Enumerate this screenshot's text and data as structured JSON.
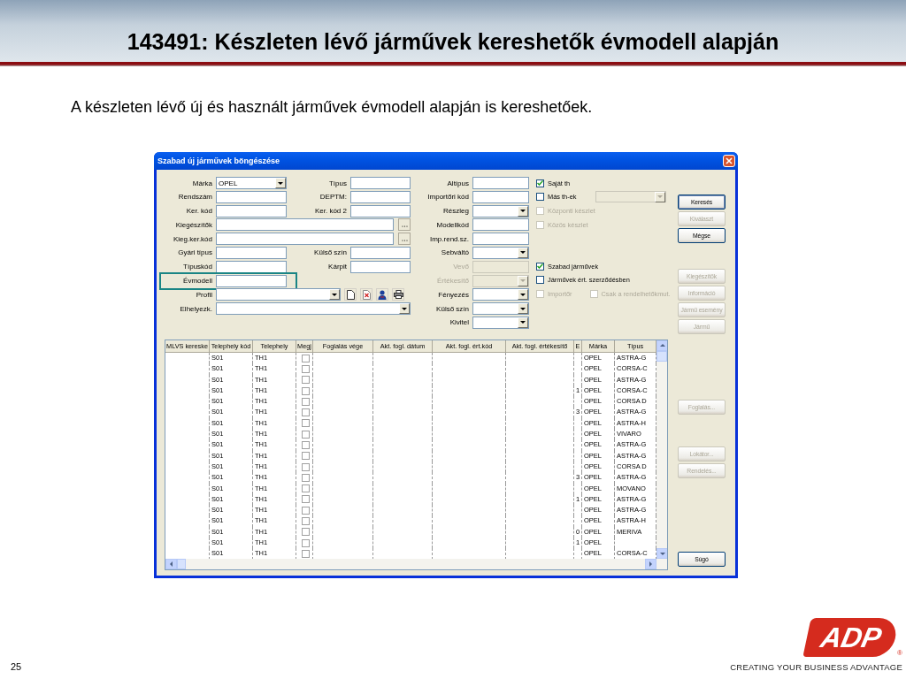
{
  "slide": {
    "title": "143491: Készleten lévő járművek kereshetők évmodell alapján",
    "subtitle": "A készleten lévő új és használt járművek évmodell alapján is kereshetőek.",
    "page_number": "25",
    "logo_text": "ADP",
    "logo_mark": "®",
    "tagline": "CREATING YOUR BUSINESS ADVANTAGE"
  },
  "window": {
    "title": "Szabad új járművek böngészése",
    "form_rows": [
      {
        "left": {
          "label": "Márka",
          "kind": "dropdown",
          "value": "OPEL",
          "disabled": false,
          "highlighted": false
        },
        "mid": {
          "label": "Típus",
          "kind": "text",
          "disabled": false
        },
        "right": {
          "label": "Altípus",
          "kind": "text",
          "disabled": false
        }
      },
      {
        "left": {
          "label": "Rendszám",
          "kind": "text",
          "disabled": false,
          "highlighted": false
        },
        "mid": {
          "label": "DEPTM:",
          "kind": "text",
          "disabled": false
        },
        "right": {
          "label": "Importőri kód",
          "kind": "text",
          "disabled": false
        }
      },
      {
        "left": {
          "label": "Ker. kód",
          "kind": "text",
          "disabled": false,
          "highlighted": false
        },
        "mid": {
          "label": "Ker. kód 2",
          "kind": "text",
          "disabled": false
        },
        "right": {
          "label": "Részleg",
          "kind": "dropdown",
          "disabled": false
        }
      },
      {
        "left": {
          "label": "Kiegészítők",
          "kind": "lookup",
          "disabled": false,
          "highlighted": false
        },
        "right": {
          "label": "Modellkód",
          "kind": "text",
          "disabled": false
        }
      },
      {
        "left": {
          "label": "Kieg.ker.kód",
          "kind": "lookup",
          "disabled": false,
          "highlighted": false
        },
        "right": {
          "label": "Imp.rend.sz.",
          "kind": "text",
          "disabled": false
        }
      },
      {
        "left": {
          "label": "Gyári típus",
          "kind": "text",
          "disabled": false,
          "highlighted": false
        },
        "mid": {
          "label": "Külső szín",
          "kind": "text",
          "disabled": false
        },
        "right": {
          "label": "Sebváltó",
          "kind": "dropdown",
          "disabled": false
        }
      },
      {
        "left": {
          "label": "Típuskód",
          "kind": "text",
          "disabled": false,
          "highlighted": false
        },
        "mid": {
          "label": "Kárpit",
          "kind": "text",
          "disabled": false
        },
        "right": {
          "label": "Vevő",
          "kind": "text",
          "disabled": true
        }
      },
      {
        "left": {
          "label": "Évmodell",
          "kind": "text",
          "disabled": false,
          "highlighted": true
        },
        "right": {
          "label": "Értékesítő",
          "kind": "dropdown",
          "disabled": true
        }
      },
      {
        "left": {
          "label": "Profil",
          "kind": "profile",
          "disabled": false,
          "highlighted": false
        },
        "right": {
          "label": "Fényezés",
          "kind": "dropdown",
          "disabled": false
        }
      },
      {
        "left": {
          "label": "Elhelyezk.",
          "kind": "wide_dropdown",
          "disabled": false,
          "highlighted": false
        },
        "right": {
          "label": "Külső szín",
          "kind": "dropdown",
          "disabled": false
        }
      },
      {
        "right": {
          "label": "Kivitel",
          "kind": "dropdown",
          "disabled": false
        }
      }
    ],
    "option_blocks": [
      {
        "lines": [
          [
            {
              "kind": "checkbox",
              "label": "Saját th",
              "checked": true,
              "disabled": false
            }
          ],
          [
            {
              "kind": "checkbox",
              "label": "Más th-ek",
              "checked": false,
              "disabled": false
            },
            {
              "kind": "combo",
              "disabled": true
            }
          ],
          [
            {
              "kind": "checkbox",
              "label": "Központi készlet",
              "checked": false,
              "disabled": true
            }
          ],
          [
            {
              "kind": "checkbox",
              "label": "Közös készlet",
              "checked": false,
              "disabled": true
            }
          ]
        ]
      },
      {
        "lines": [
          [
            {
              "kind": "checkbox",
              "label": "Szabad járművek",
              "checked": true,
              "disabled": false
            }
          ],
          [
            {
              "kind": "checkbox",
              "label": "Járművek ért. szerződésben",
              "checked": false,
              "disabled": false
            }
          ],
          [
            {
              "kind": "checkbox",
              "label": "Importőr",
              "checked": false,
              "disabled": true
            },
            {
              "kind": "checkbox",
              "label": "Csak a rendelhetőkmut.",
              "checked": false,
              "disabled": true
            }
          ]
        ]
      }
    ],
    "button_groups": [
      [
        {
          "label": "Keresés",
          "disabled": false,
          "default": true
        },
        {
          "label": "Kiválaszt",
          "disabled": true,
          "default": false
        },
        {
          "label": "Mégse",
          "disabled": false,
          "default": false
        }
      ],
      [
        {
          "label": "Kiegészítők",
          "disabled": true,
          "default": false
        },
        {
          "label": "Információ",
          "disabled": true,
          "default": false
        },
        {
          "label": "Jármű esemény",
          "disabled": true,
          "default": false
        },
        {
          "label": "Jármű",
          "disabled": true,
          "default": false
        }
      ],
      [
        {
          "label": "Foglalás...",
          "disabled": true,
          "default": false
        }
      ],
      [
        {
          "label": "Lokátor...",
          "disabled": true,
          "default": false
        },
        {
          "label": "Rendelés...",
          "disabled": true,
          "default": false
        }
      ]
    ],
    "help_button": {
      "label": "Súgó",
      "disabled": false
    },
    "table": {
      "columns": [
        "MLVS kereske",
        "Telephely kód",
        "Telephely",
        "Megj",
        "Foglalás vége",
        "Akt. fogl. dátum",
        "Akt. fogl. ért.kód",
        "Akt. fogl. értékesítő",
        "E",
        "Márka",
        "Típus"
      ],
      "rows": [
        {
          "telephely_kod": "S01",
          "telephely": "TH1",
          "checked": false,
          "marka": "OPEL",
          "tipus": "ASTRA-G"
        },
        {
          "telephely_kod": "S01",
          "telephely": "TH1",
          "checked": false,
          "marka": "OPEL",
          "tipus": "CORSA-C"
        },
        {
          "telephely_kod": "S01",
          "telephely": "TH1",
          "checked": false,
          "marka": "OPEL",
          "tipus": "ASTRA-G"
        },
        {
          "telephely_kod": "S01",
          "telephely": "TH1",
          "checked": false,
          "e": "1",
          "marka": "OPEL",
          "tipus": "CORSA-C"
        },
        {
          "telephely_kod": "S01",
          "telephely": "TH1",
          "checked": false,
          "marka": "OPEL",
          "tipus": "CORSA D"
        },
        {
          "telephely_kod": "S01",
          "telephely": "TH1",
          "checked": false,
          "e": "3",
          "marka": "OPEL",
          "tipus": "ASTRA-G"
        },
        {
          "telephely_kod": "S01",
          "telephely": "TH1",
          "checked": false,
          "marka": "OPEL",
          "tipus": "ASTRA-H"
        },
        {
          "telephely_kod": "S01",
          "telephely": "TH1",
          "checked": false,
          "marka": "OPEL",
          "tipus": "VIVARO"
        },
        {
          "telephely_kod": "S01",
          "telephely": "TH1",
          "checked": false,
          "marka": "OPEL",
          "tipus": "ASTRA-G"
        },
        {
          "telephely_kod": "S01",
          "telephely": "TH1",
          "checked": false,
          "marka": "OPEL",
          "tipus": "ASTRA-G"
        },
        {
          "telephely_kod": "S01",
          "telephely": "TH1",
          "checked": false,
          "marka": "OPEL",
          "tipus": "CORSA D"
        },
        {
          "telephely_kod": "S01",
          "telephely": "TH1",
          "checked": false,
          "e": "3",
          "marka": "OPEL",
          "tipus": "ASTRA-G"
        },
        {
          "telephely_kod": "S01",
          "telephely": "TH1",
          "checked": false,
          "marka": "OPEL",
          "tipus": "MOVANO"
        },
        {
          "telephely_kod": "S01",
          "telephely": "TH1",
          "checked": false,
          "e": "1",
          "marka": "OPEL",
          "tipus": "ASTRA-G"
        },
        {
          "telephely_kod": "S01",
          "telephely": "TH1",
          "checked": false,
          "marka": "OPEL",
          "tipus": "ASTRA-G"
        },
        {
          "telephely_kod": "S01",
          "telephely": "TH1",
          "checked": false,
          "marka": "OPEL",
          "tipus": "ASTRA-H"
        },
        {
          "telephely_kod": "S01",
          "telephely": "TH1",
          "checked": false,
          "e": "0",
          "marka": "OPEL",
          "tipus": "MERIVA"
        },
        {
          "telephely_kod": "S01",
          "telephely": "TH1",
          "checked": false,
          "e": "1",
          "marka": "OPEL"
        },
        {
          "telephely_kod": "S01",
          "telephely": "TH1",
          "checked": false,
          "marka": "OPEL",
          "tipus": "CORSA-C"
        }
      ]
    }
  }
}
